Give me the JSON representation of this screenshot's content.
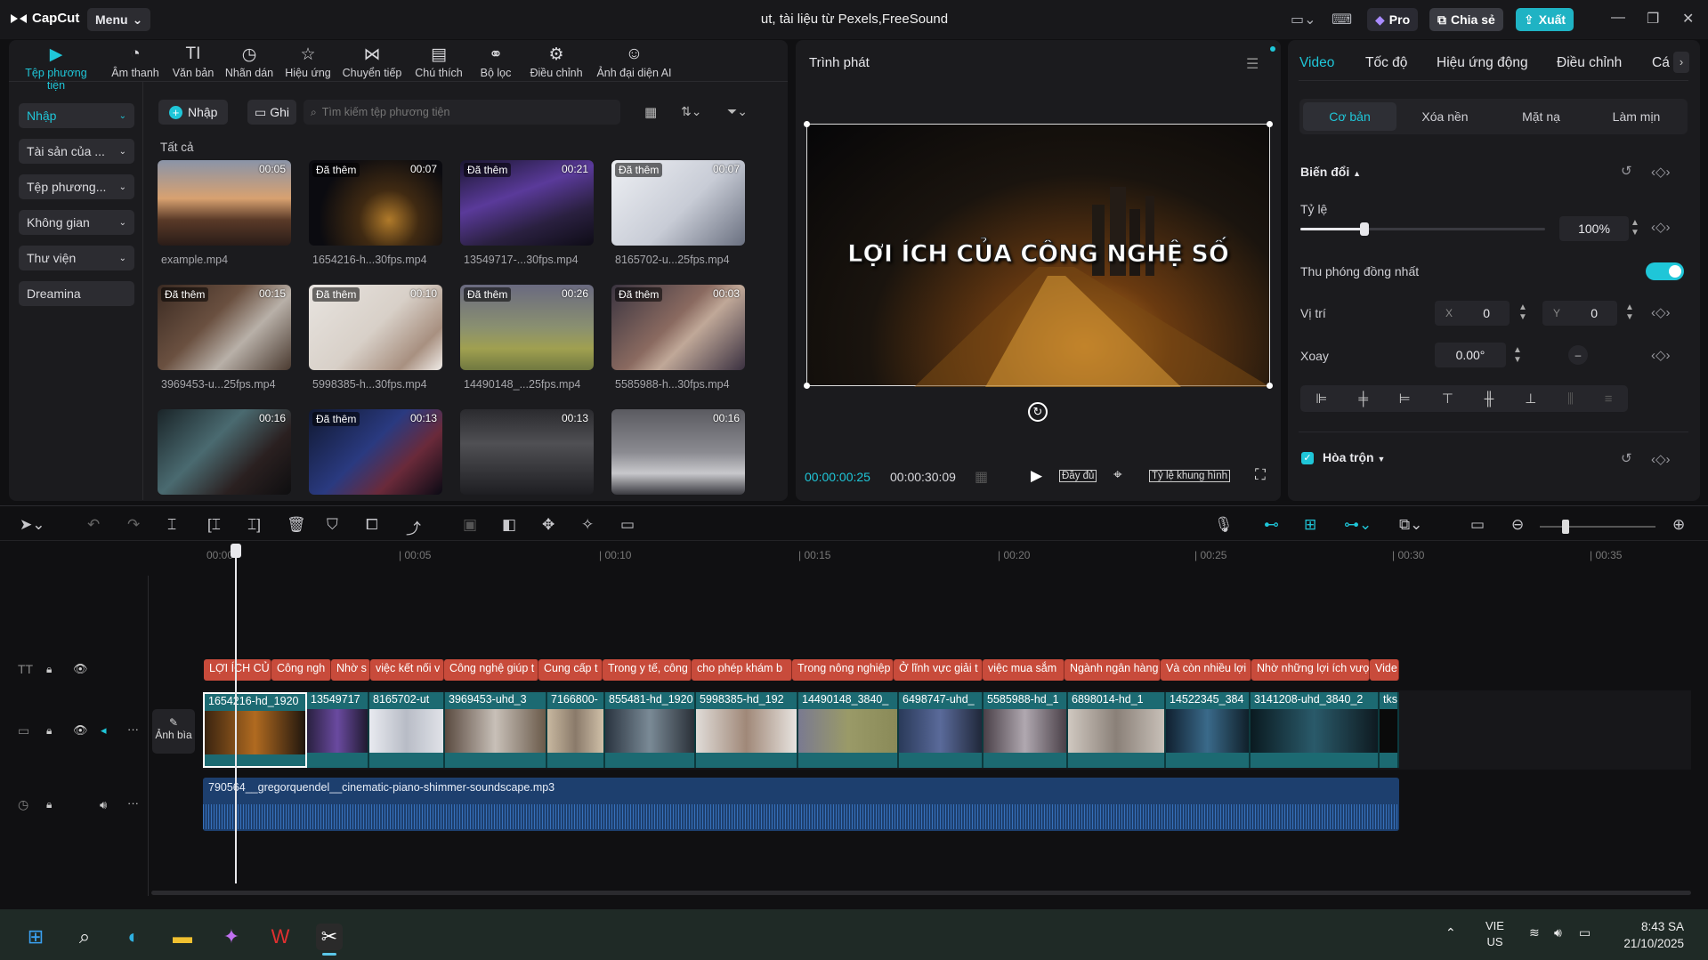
{
  "app": {
    "name": "CapCut",
    "menu_label": "Menu",
    "project_title": "ut, tài liệu từ Pexels,FreeSound",
    "pro_label": "Pro",
    "share_label": "Chia sẻ",
    "export_label": "Xuất"
  },
  "media_tabs": [
    {
      "label": "Tệp phương tiện",
      "icon": "media-icon"
    },
    {
      "label": "Âm thanh",
      "icon": "audio-icon"
    },
    {
      "label": "Văn bản",
      "icon": "text-icon"
    },
    {
      "label": "Nhãn dán",
      "icon": "sticker-icon"
    },
    {
      "label": "Hiệu ứng",
      "icon": "effects-icon"
    },
    {
      "label": "Chuyển tiếp",
      "icon": "transition-icon"
    },
    {
      "label": "Chú thích",
      "icon": "caption-icon"
    },
    {
      "label": "Bộ lọc",
      "icon": "filter-icon"
    },
    {
      "label": "Điều chỉnh",
      "icon": "adjust-icon"
    },
    {
      "label": "Ảnh đại diện AI",
      "icon": "ai-avatar-icon"
    }
  ],
  "sidebar": [
    {
      "label": "Nhập"
    },
    {
      "label": "Tài sản của ..."
    },
    {
      "label": "Tệp phương..."
    },
    {
      "label": "Không gian"
    },
    {
      "label": "Thư viện"
    },
    {
      "label": "Dreamina"
    }
  ],
  "media_toolbar": {
    "import_label": "Nhập",
    "record_label": "Ghi",
    "search_placeholder": "Tìm kiếm tệp phương tiện",
    "section": "Tất cả"
  },
  "media_items": [
    {
      "name": "example.mp4",
      "added": "",
      "duration": "00:05"
    },
    {
      "name": "1654216-h...30fps.mp4",
      "added": "Đã thêm",
      "duration": "00:07"
    },
    {
      "name": "13549717-...30fps.mp4",
      "added": "Đã thêm",
      "duration": "00:21"
    },
    {
      "name": "8165702-u...25fps.mp4",
      "added": "Đã thêm",
      "duration": "00:07"
    },
    {
      "name": "3969453-u...25fps.mp4",
      "added": "Đã thêm",
      "duration": "00:15"
    },
    {
      "name": "5998385-h...30fps.mp4",
      "added": "Đã thêm",
      "duration": "00:10"
    },
    {
      "name": "14490148_...25fps.mp4",
      "added": "Đã thêm",
      "duration": "00:26"
    },
    {
      "name": "5585988-h...30fps.mp4",
      "added": "Đã thêm",
      "duration": "00:03"
    },
    {
      "name": "",
      "added": "",
      "duration": "00:16"
    },
    {
      "name": "",
      "added": "Đã thêm",
      "duration": "00:13"
    },
    {
      "name": "",
      "added": "",
      "duration": "00:13"
    },
    {
      "name": "",
      "added": "",
      "duration": "00:16"
    }
  ],
  "player": {
    "title": "Trình phát",
    "overlay_text": "LỢI ÍCH CỦA CÔNG NGHỆ SỐ",
    "current_time": "00:00:00:25",
    "total_time": "00:00:30:09",
    "full_label": "Đầy đủ",
    "ratio_label": "Tỷ lệ khung hình"
  },
  "properties": {
    "tabs": [
      "Video",
      "Tốc độ",
      "Hiệu ứng động",
      "Điều chỉnh",
      "Cá"
    ],
    "subtabs": [
      "Cơ bản",
      "Xóa nền",
      "Mặt nạ",
      "Làm mịn"
    ],
    "transform_label": "Biến đổi",
    "scale_label": "Tỷ lệ",
    "scale_value": "100%",
    "scale_fraction": 0.26,
    "uniform_label": "Thu phóng đồng nhất",
    "uniform_on": true,
    "position_label": "Vị trí",
    "x_label": "X",
    "x_value": "0",
    "y_label": "Y",
    "y_value": "0",
    "rotate_label": "Xoay",
    "rotate_value": "0.00°",
    "blend_label": "Hòa trộn"
  },
  "timeline": {
    "ticks": [
      "00:00",
      "| 00:05",
      "| 00:10",
      "| 00:15",
      "| 00:20",
      "| 00:25",
      "| 00:30",
      "| 00:35"
    ],
    "cover_label": "Ảnh bìa",
    "text_clips": [
      "LỢI ÍCH CỦ",
      "Công ngh",
      "Nhờ s",
      "việc kết nối v",
      "Công nghệ giúp t",
      "Cung cấp t",
      "Trong y tế, công",
      "cho phép khám b",
      "Trong nông nghiệp",
      "Ở lĩnh vực giải t",
      "việc mua sắm",
      "Ngành ngân hàng",
      "Và còn nhiều lợi",
      "Nhờ những lợi ích vượ",
      "Vide"
    ],
    "video_clips": [
      "1654216-hd_1920",
      "13549717",
      "8165702-ut",
      "3969453-uhd_3",
      "7166800-",
      "855481-hd_1920",
      "5998385-hd_192",
      "14490148_3840_",
      "6498747-uhd_",
      "5585988-hd_1",
      "6898014-hd_1",
      "14522345_384",
      "3141208-uhd_3840_2",
      "tks"
    ],
    "audio_clip": "790564__gregorquendel__cinematic-piano-shimmer-soundscape.mp3"
  },
  "taskbar": {
    "lang": "VIE",
    "region": "US",
    "time": "8:43 SA",
    "date": "21/10/2025"
  },
  "colors": {
    "accent": "#1fc6d8",
    "text_clip": "#c84b3b",
    "video_clip": "#1c6a72",
    "audio_clip": "#1d3f6e"
  }
}
